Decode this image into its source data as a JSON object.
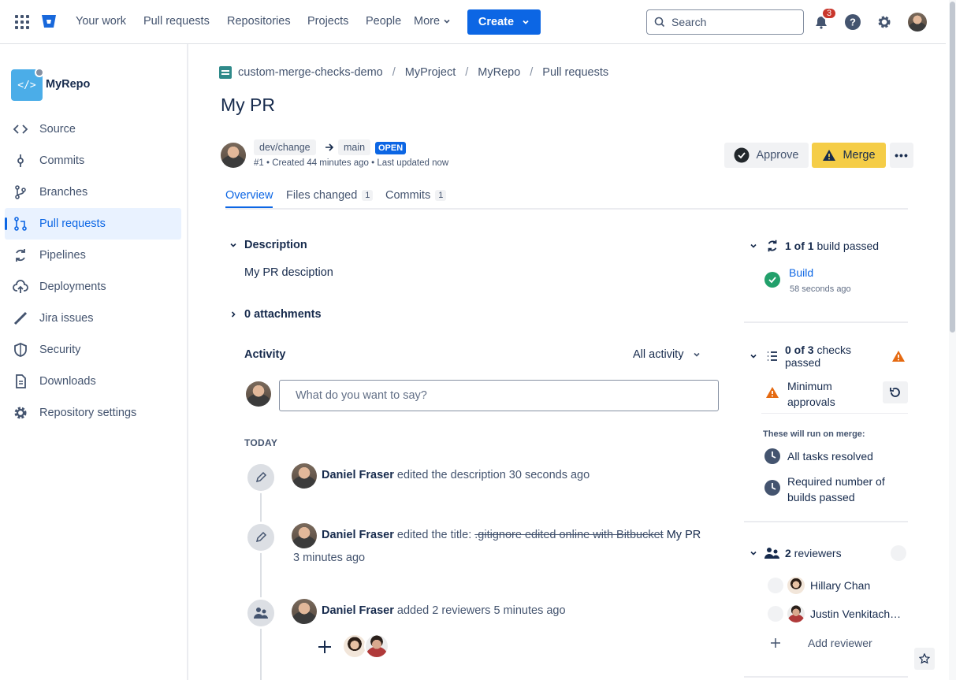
{
  "nav": {
    "links": [
      "Your work",
      "Pull requests",
      "Repositories",
      "Projects",
      "People",
      "More"
    ],
    "create_label": "Create",
    "search_placeholder": "Search",
    "notification_count": "3"
  },
  "sidebar": {
    "repo_name": "MyRepo",
    "items": [
      {
        "label": "Source",
        "icon": "code-icon"
      },
      {
        "label": "Commits",
        "icon": "commit-icon"
      },
      {
        "label": "Branches",
        "icon": "branch-icon"
      },
      {
        "label": "Pull requests",
        "icon": "pull-request-icon",
        "active": true
      },
      {
        "label": "Pipelines",
        "icon": "pipelines-icon"
      },
      {
        "label": "Deployments",
        "icon": "deployments-icon"
      },
      {
        "label": "Jira issues",
        "icon": "jira-icon"
      },
      {
        "label": "Security",
        "icon": "shield-icon"
      },
      {
        "label": "Downloads",
        "icon": "document-icon"
      },
      {
        "label": "Repository settings",
        "icon": "gear-icon"
      }
    ]
  },
  "breadcrumb": [
    "custom-merge-checks-demo",
    "MyProject",
    "MyRepo",
    "Pull requests"
  ],
  "pr": {
    "title": "My PR",
    "source_branch": "dev/change",
    "target_branch": "main",
    "status": "OPEN",
    "meta": "#1 • Created 44 minutes ago • Last updated now",
    "approve_label": "Approve",
    "merge_label": "Merge",
    "more_label": "•••"
  },
  "tabs": [
    {
      "label": "Overview",
      "count": ""
    },
    {
      "label": "Files changed",
      "count": "1"
    },
    {
      "label": "Commits",
      "count": "1"
    }
  ],
  "overview": {
    "description_heading": "Description",
    "description": "My PR desciption",
    "attachments": "0 attachments",
    "activity_heading": "Activity",
    "activity_filter": "All activity",
    "comment_placeholder": "What do you want to say?",
    "today_label": "TODAY"
  },
  "events": [
    {
      "author": "Daniel Fraser",
      "action": "edited the description",
      "time": "30 seconds ago"
    },
    {
      "author": "Daniel Fraser",
      "action": "edited the title:",
      "old_title": ".gitignore edited online with Bitbucket",
      "new_title": "My PR",
      "time": "3 minutes ago"
    },
    {
      "author": "Daniel Fraser",
      "action": "added 2 reviewers",
      "time": "5 minutes ago"
    }
  ],
  "builds": {
    "summary_bold": "1 of 1",
    "summary_rest": " build passed",
    "name": "Build",
    "time": "58 seconds ago"
  },
  "checks": {
    "summary_bold": "0 of 3",
    "summary_rest": " checks",
    "summary_line2": "passed",
    "items": [
      {
        "label_line1": "Minimum",
        "label_line2": "approvals"
      }
    ],
    "on_merge_heading": "These will run on merge:",
    "on_merge": [
      {
        "label_line1": "All tasks resolved",
        "label_line2": ""
      },
      {
        "label_line1": "Required number of",
        "label_line2": "builds passed"
      }
    ]
  },
  "reviewers": {
    "summary_bold": "2",
    "summary_rest": " reviewers",
    "list": [
      "Hillary Chan",
      "Justin Venkitach…"
    ],
    "add_label": "Add reviewer"
  },
  "colors": {
    "brand": "#0c66e4",
    "merge": "#f5cd47",
    "success": "#22a06b",
    "warning": "#e56910"
  }
}
